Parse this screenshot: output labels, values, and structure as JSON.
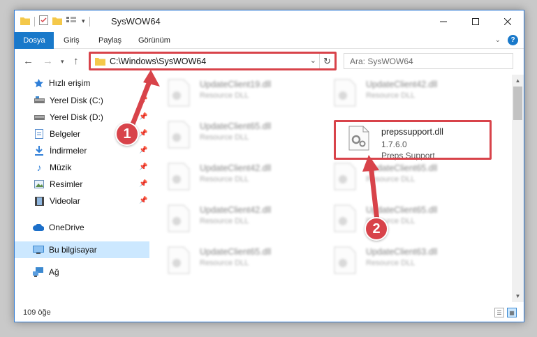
{
  "window": {
    "title": "SysWOW64"
  },
  "ribbon": {
    "tabs": [
      {
        "label": "Dosya"
      },
      {
        "label": "Giriş"
      },
      {
        "label": "Paylaş"
      },
      {
        "label": "Görünüm"
      }
    ]
  },
  "nav": {
    "address": "C:\\Windows\\SysWOW64",
    "search_placeholder": "Ara: SysWOW64"
  },
  "sidebar": {
    "items": [
      {
        "label": "Hızlı erişim"
      },
      {
        "label": "Yerel Disk (C:)"
      },
      {
        "label": "Yerel Disk (D:)"
      },
      {
        "label": "Belgeler"
      },
      {
        "label": "İndirmeler"
      },
      {
        "label": "Müzik"
      },
      {
        "label": "Resimler"
      },
      {
        "label": "Videolar"
      },
      {
        "label": "OneDrive"
      },
      {
        "label": "Bu bilgisayar"
      },
      {
        "label": "Ağ"
      }
    ]
  },
  "files": [
    {
      "name": "UpdateClient19.dll",
      "desc": "Resource DLL"
    },
    {
      "name": "UpdateClient42.dll",
      "desc": "Resource DLL"
    },
    {
      "name": "UpdateClient65.dll",
      "desc": "Resource DLL"
    },
    {
      "name": "UpdateClient42.dll",
      "desc": "Resource DLL"
    },
    {
      "name": "UpdateClient65.dll",
      "desc": "Resource DLL"
    },
    {
      "name": "UpdateClient42.dll",
      "desc": "Resource DLL"
    },
    {
      "name": "UpdateClient65.dll",
      "desc": "Resource DLL"
    },
    {
      "name": "UpdateClient65.dll",
      "desc": "Resource DLL"
    },
    {
      "name": "UpdateClient63.dll",
      "desc": "Resource DLL"
    }
  ],
  "highlighted_file": {
    "name": "prepssupport.dll",
    "version": "1.7.6.0",
    "company": "Preps Support"
  },
  "status": {
    "count": "109 öğe"
  },
  "annotations": {
    "step1": "1",
    "step2": "2"
  },
  "colors": {
    "accent": "#1979ca",
    "highlight": "#d8434a",
    "selected": "#cce8ff"
  }
}
